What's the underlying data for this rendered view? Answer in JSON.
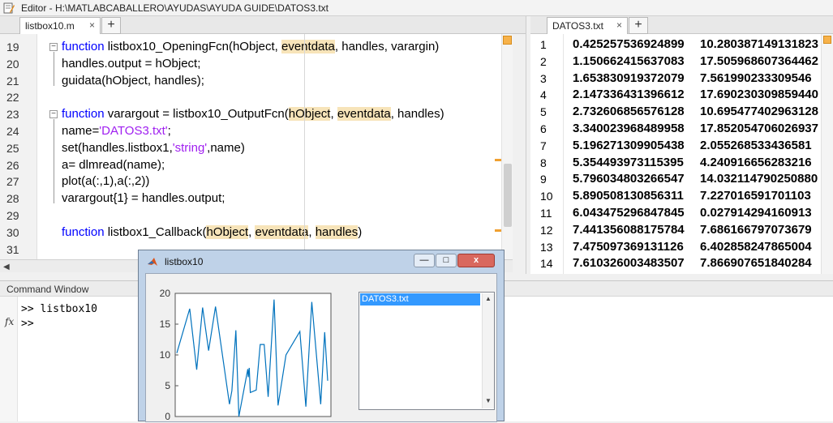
{
  "editor": {
    "title": "Editor - H:\\MATLABCABALLERO\\AYUDAS\\AYUDA GUIDE\\DATOS3.txt",
    "tab_label": "listbox10.m",
    "tab_close": "×",
    "add_tab": "+",
    "lines": [
      {
        "n": "19",
        "parts": [
          {
            "t": "function",
            "c": "kw"
          },
          {
            "t": " listbox10_OpeningFcn(hObject, "
          },
          {
            "t": "eventdata",
            "c": "hl"
          },
          {
            "t": ", handles, varargin)"
          }
        ]
      },
      {
        "n": "20",
        "parts": [
          {
            "t": "handles.output = hObject;"
          }
        ]
      },
      {
        "n": "21",
        "parts": [
          {
            "t": "guidata(hObject, handles);"
          }
        ]
      },
      {
        "n": "22",
        "parts": []
      },
      {
        "n": "23",
        "parts": [
          {
            "t": "function",
            "c": "kw"
          },
          {
            "t": " varargout = listbox10_OutputFcn("
          },
          {
            "t": "hObject",
            "c": "hl"
          },
          {
            "t": ", "
          },
          {
            "t": "eventdata",
            "c": "hl"
          },
          {
            "t": ", handles)"
          }
        ]
      },
      {
        "n": "24",
        "parts": [
          {
            "t": "name="
          },
          {
            "t": "'DATOS3.txt'",
            "c": "str"
          },
          {
            "t": ";"
          }
        ]
      },
      {
        "n": "25",
        "parts": [
          {
            "t": "set(handles.listbox1,"
          },
          {
            "t": "'string'",
            "c": "str"
          },
          {
            "t": ",name)"
          }
        ]
      },
      {
        "n": "26",
        "parts": [
          {
            "t": "a= dlmread(name);"
          }
        ]
      },
      {
        "n": "27",
        "parts": [
          {
            "t": "plot(a(:,1),a(:,2))"
          }
        ]
      },
      {
        "n": "28",
        "parts": [
          {
            "t": "varargout{1} = handles.output;"
          }
        ]
      },
      {
        "n": "29",
        "parts": []
      },
      {
        "n": "30",
        "parts": [
          {
            "t": "function",
            "c": "kw"
          },
          {
            "t": " listbox1_Callback("
          },
          {
            "t": "hObject",
            "c": "hl"
          },
          {
            "t": ", "
          },
          {
            "t": "eventdata",
            "c": "hl"
          },
          {
            "t": ", "
          },
          {
            "t": "handles",
            "c": "hl"
          },
          {
            "t": ")"
          }
        ]
      },
      {
        "n": "31",
        "parts": []
      }
    ]
  },
  "datafile": {
    "tab_label": "DATOS3.txt",
    "tab_close": "×",
    "add_tab": "+",
    "rows": [
      {
        "n": "1",
        "x": "0.425257536924899",
        "y": "10.280387149131823"
      },
      {
        "n": "2",
        "x": "1.150662415637083",
        "y": "17.505968607364462"
      },
      {
        "n": "3",
        "x": "1.653830919372079",
        "y": "7.561990233309546"
      },
      {
        "n": "4",
        "x": "2.147336431396612",
        "y": "17.690230309859440"
      },
      {
        "n": "5",
        "x": "2.732606856576128",
        "y": "10.695477402963128"
      },
      {
        "n": "6",
        "x": "3.340023968489958",
        "y": "17.852054706026937"
      },
      {
        "n": "7",
        "x": "5.196271309905438",
        "y": "2.055268533436581"
      },
      {
        "n": "8",
        "x": "5.354493973115395",
        "y": "4.240916656283216"
      },
      {
        "n": "9",
        "x": "5.796034803266547",
        "y": "14.032114790250880"
      },
      {
        "n": "10",
        "x": "5.890508130856311",
        "y": "7.227016591701103"
      },
      {
        "n": "11",
        "x": "6.043475296847845",
        "y": "0.027914294160913"
      },
      {
        "n": "12",
        "x": "7.441356088175784",
        "y": "7.686166797073679"
      },
      {
        "n": "13",
        "x": "7.475097369131126",
        "y": "6.402858247865004"
      },
      {
        "n": "14",
        "x": "7.610326003483507",
        "y": "7.866907651840284"
      }
    ]
  },
  "command_window": {
    "title": "Command Window",
    "fx": "fx",
    "lines": [
      ">> listbox10",
      ">>"
    ]
  },
  "figure": {
    "title": "listbox10",
    "minimize": "—",
    "maximize": "□",
    "close": "x",
    "listbox_selected": "DATOS3.txt",
    "accent": "#3399ff",
    "line_color": "#0072bd"
  },
  "chart_data": {
    "type": "line",
    "yticks": [
      "20",
      "15",
      "10",
      "5",
      "0"
    ],
    "ylim": [
      0,
      20
    ],
    "series": [
      {
        "values": [
          [
            0.0,
            10.3
          ],
          [
            0.13,
            17.5
          ],
          [
            0.2,
            7.6
          ],
          [
            0.26,
            17.7
          ],
          [
            0.32,
            10.7
          ],
          [
            0.39,
            17.85
          ],
          [
            0.53,
            2.0
          ],
          [
            0.555,
            4.2
          ],
          [
            0.595,
            14.0
          ],
          [
            0.61,
            7.2
          ],
          [
            0.625,
            0.0
          ],
          [
            0.715,
            7.7
          ],
          [
            0.72,
            6.4
          ],
          [
            0.73,
            7.9
          ],
          [
            0.74,
            3.9
          ],
          [
            0.8,
            4.3
          ],
          [
            0.84,
            11.7
          ],
          [
            0.88,
            11.7
          ],
          [
            0.92,
            3.2
          ],
          [
            0.98,
            19.0
          ],
          [
            1.02,
            1.8
          ],
          [
            1.1,
            10.0
          ],
          [
            1.24,
            13.8
          ],
          [
            1.3,
            1.6
          ],
          [
            1.36,
            18.6
          ],
          [
            1.45,
            2.0
          ],
          [
            1.49,
            13.7
          ],
          [
            1.52,
            5.8
          ]
        ]
      }
    ]
  }
}
